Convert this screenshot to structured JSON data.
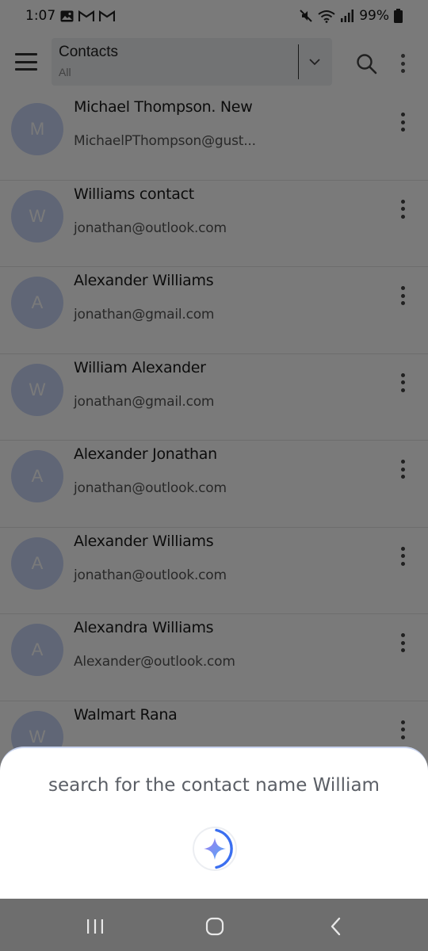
{
  "status_bar": {
    "time": "1:07",
    "battery": "99%",
    "icons": [
      "gallery-icon",
      "gmail-icon",
      "gmail-icon",
      "mute-icon",
      "wifi-icon",
      "signal-icon",
      "battery-icon"
    ]
  },
  "app_bar": {
    "title": "Contacts",
    "subtitle": "All",
    "icons": [
      "menu-icon",
      "chevron-down-icon",
      "search-icon",
      "more-vert-icon"
    ]
  },
  "contacts": [
    {
      "initial": "M",
      "name": "Michael Thompson. New",
      "email": "MichaelPThompson@gust..."
    },
    {
      "initial": "W",
      "name": "Williams contact",
      "email": "jonathan@outlook.com"
    },
    {
      "initial": "A",
      "name": "Alexander Williams",
      "email": "jonathan@gmail.com"
    },
    {
      "initial": "W",
      "name": "William Alexander",
      "email": "jonathan@gmail.com"
    },
    {
      "initial": "A",
      "name": "Alexander Jonathan",
      "email": "jonathan@outlook.com"
    },
    {
      "initial": "A",
      "name": "Alexander Williams",
      "email": "jonathan@outlook.com"
    },
    {
      "initial": "A",
      "name": "Alexandra Williams",
      "email": "Alexander@outlook.com"
    },
    {
      "initial": "W",
      "name": "Walmart Rana",
      "email": ""
    }
  ],
  "assistant_sheet": {
    "query": "search for the contact name William",
    "icon": "sparkle-icon"
  },
  "nav_bar": {
    "icons": [
      "recents-icon",
      "home-icon",
      "back-icon"
    ]
  },
  "colors": {
    "avatar": "#c9d5f7",
    "scrim": "rgba(0,0,0,0.52)",
    "accent": "#3b6ff0",
    "nav_bar": "#6e6e6e"
  }
}
